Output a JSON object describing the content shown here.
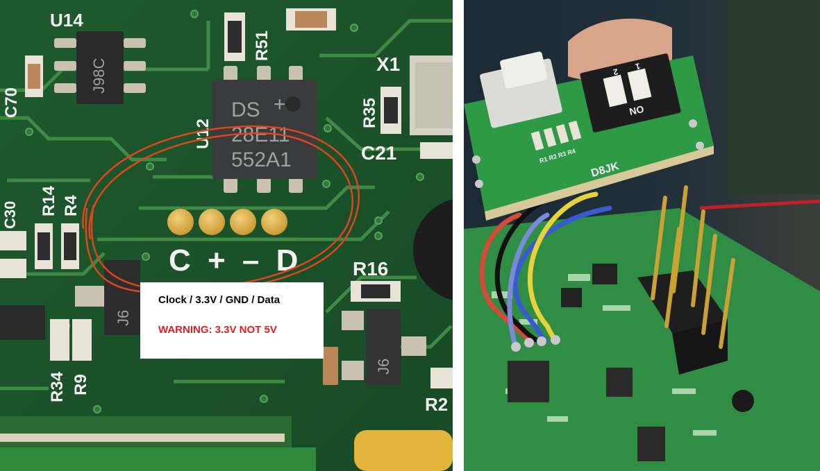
{
  "left_photo": {
    "silkscreen": {
      "u14": "U14",
      "u14_chip": "J98C",
      "r51": "R51",
      "x1": "X1",
      "r35": "R35",
      "c21": "C21",
      "chip_line1": "DS",
      "chip_line2": "28E11",
      "chip_line3": "552A1",
      "u12": "U12",
      "r14": "R14",
      "r4": "R4",
      "r16": "R16",
      "j6": "J6",
      "j6_left": "J6",
      "r34": "R34",
      "r9": "R9",
      "r2": "R2",
      "pad_labels": "C + – D",
      "c30": "C30",
      "c70": "C70"
    }
  },
  "annotation": {
    "pin_order": "Clock / 3.3V / GND / Data",
    "warning": "WARNING: 3.3V NOT 5V",
    "warning_color": "#e02020",
    "circle_color": "#e0451e"
  },
  "right_photo": {
    "silkscreen": {
      "module_label": "D8JK",
      "dip_on": "ON",
      "dip_1": "1",
      "dip_2": "2",
      "r_labels": "R1 R2 R3 R4"
    }
  }
}
